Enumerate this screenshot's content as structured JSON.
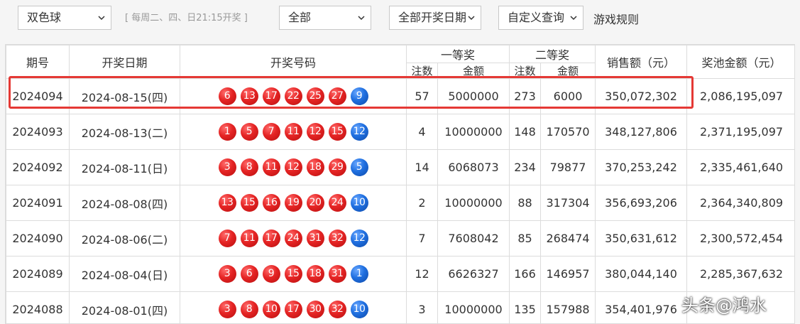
{
  "toolbar": {
    "lottery_select": "双色球",
    "schedule_hint": "[ 每周二、四、日21:15开奖 ]",
    "scope_select": "全部",
    "date_select": "全部开奖日期",
    "custom_query": "自定义查询",
    "rules_link": "游戏规则"
  },
  "table": {
    "headers": {
      "issue": "期号",
      "date": "开奖日期",
      "numbers": "开奖号码",
      "first_prize": "一等奖",
      "second_prize": "二等奖",
      "count": "注数",
      "amount": "金额",
      "sales": "销售额（元）",
      "pool": "奖池金额（元）"
    },
    "rows": [
      {
        "issue": "2024094",
        "date": "2024-08-15(四)",
        "red": [
          "6",
          "13",
          "17",
          "22",
          "25",
          "27"
        ],
        "blue": "9",
        "p1_count": "57",
        "p1_amount": "5000000",
        "p2_count": "273",
        "p2_amount": "6000",
        "sales": "350,072,302",
        "pool": "2,086,195,097"
      },
      {
        "issue": "2024093",
        "date": "2024-08-13(二)",
        "red": [
          "1",
          "5",
          "7",
          "11",
          "12",
          "15"
        ],
        "blue": "12",
        "p1_count": "4",
        "p1_amount": "10000000",
        "p2_count": "148",
        "p2_amount": "170570",
        "sales": "348,127,806",
        "pool": "2,371,195,097"
      },
      {
        "issue": "2024092",
        "date": "2024-08-11(日)",
        "red": [
          "3",
          "8",
          "11",
          "12",
          "18",
          "29"
        ],
        "blue": "5",
        "p1_count": "14",
        "p1_amount": "6068073",
        "p2_count": "234",
        "p2_amount": "79877",
        "sales": "370,253,242",
        "pool": "2,335,461,640"
      },
      {
        "issue": "2024091",
        "date": "2024-08-08(四)",
        "red": [
          "13",
          "15",
          "16",
          "19",
          "20",
          "24"
        ],
        "blue": "10",
        "p1_count": "2",
        "p1_amount": "10000000",
        "p2_count": "88",
        "p2_amount": "317304",
        "sales": "356,693,206",
        "pool": "2,364,340,809"
      },
      {
        "issue": "2024090",
        "date": "2024-08-06(二)",
        "red": [
          "7",
          "11",
          "17",
          "24",
          "31",
          "32"
        ],
        "blue": "12",
        "p1_count": "7",
        "p1_amount": "7608042",
        "p2_count": "85",
        "p2_amount": "268474",
        "sales": "350,631,612",
        "pool": "2,300,572,454"
      },
      {
        "issue": "2024089",
        "date": "2024-08-04(日)",
        "red": [
          "3",
          "6",
          "9",
          "15",
          "18",
          "31"
        ],
        "blue": "1",
        "p1_count": "12",
        "p1_amount": "6626327",
        "p2_count": "166",
        "p2_amount": "146957",
        "sales": "380,044,140",
        "pool": "2,285,367,632"
      },
      {
        "issue": "2024088",
        "date": "2024-08-01(四)",
        "red": [
          "3",
          "8",
          "10",
          "17",
          "30",
          "32"
        ],
        "blue": "10",
        "p1_count": "3",
        "p1_amount": "10000000",
        "p2_count": "135",
        "p2_amount": "157988",
        "sales": "354,401,976",
        "pool": ""
      }
    ]
  },
  "watermark": "头条@鸿水",
  "colors": {
    "red_ball": "#e52424",
    "blue_ball": "#1f6fe0",
    "highlight_border": "#e53935"
  }
}
